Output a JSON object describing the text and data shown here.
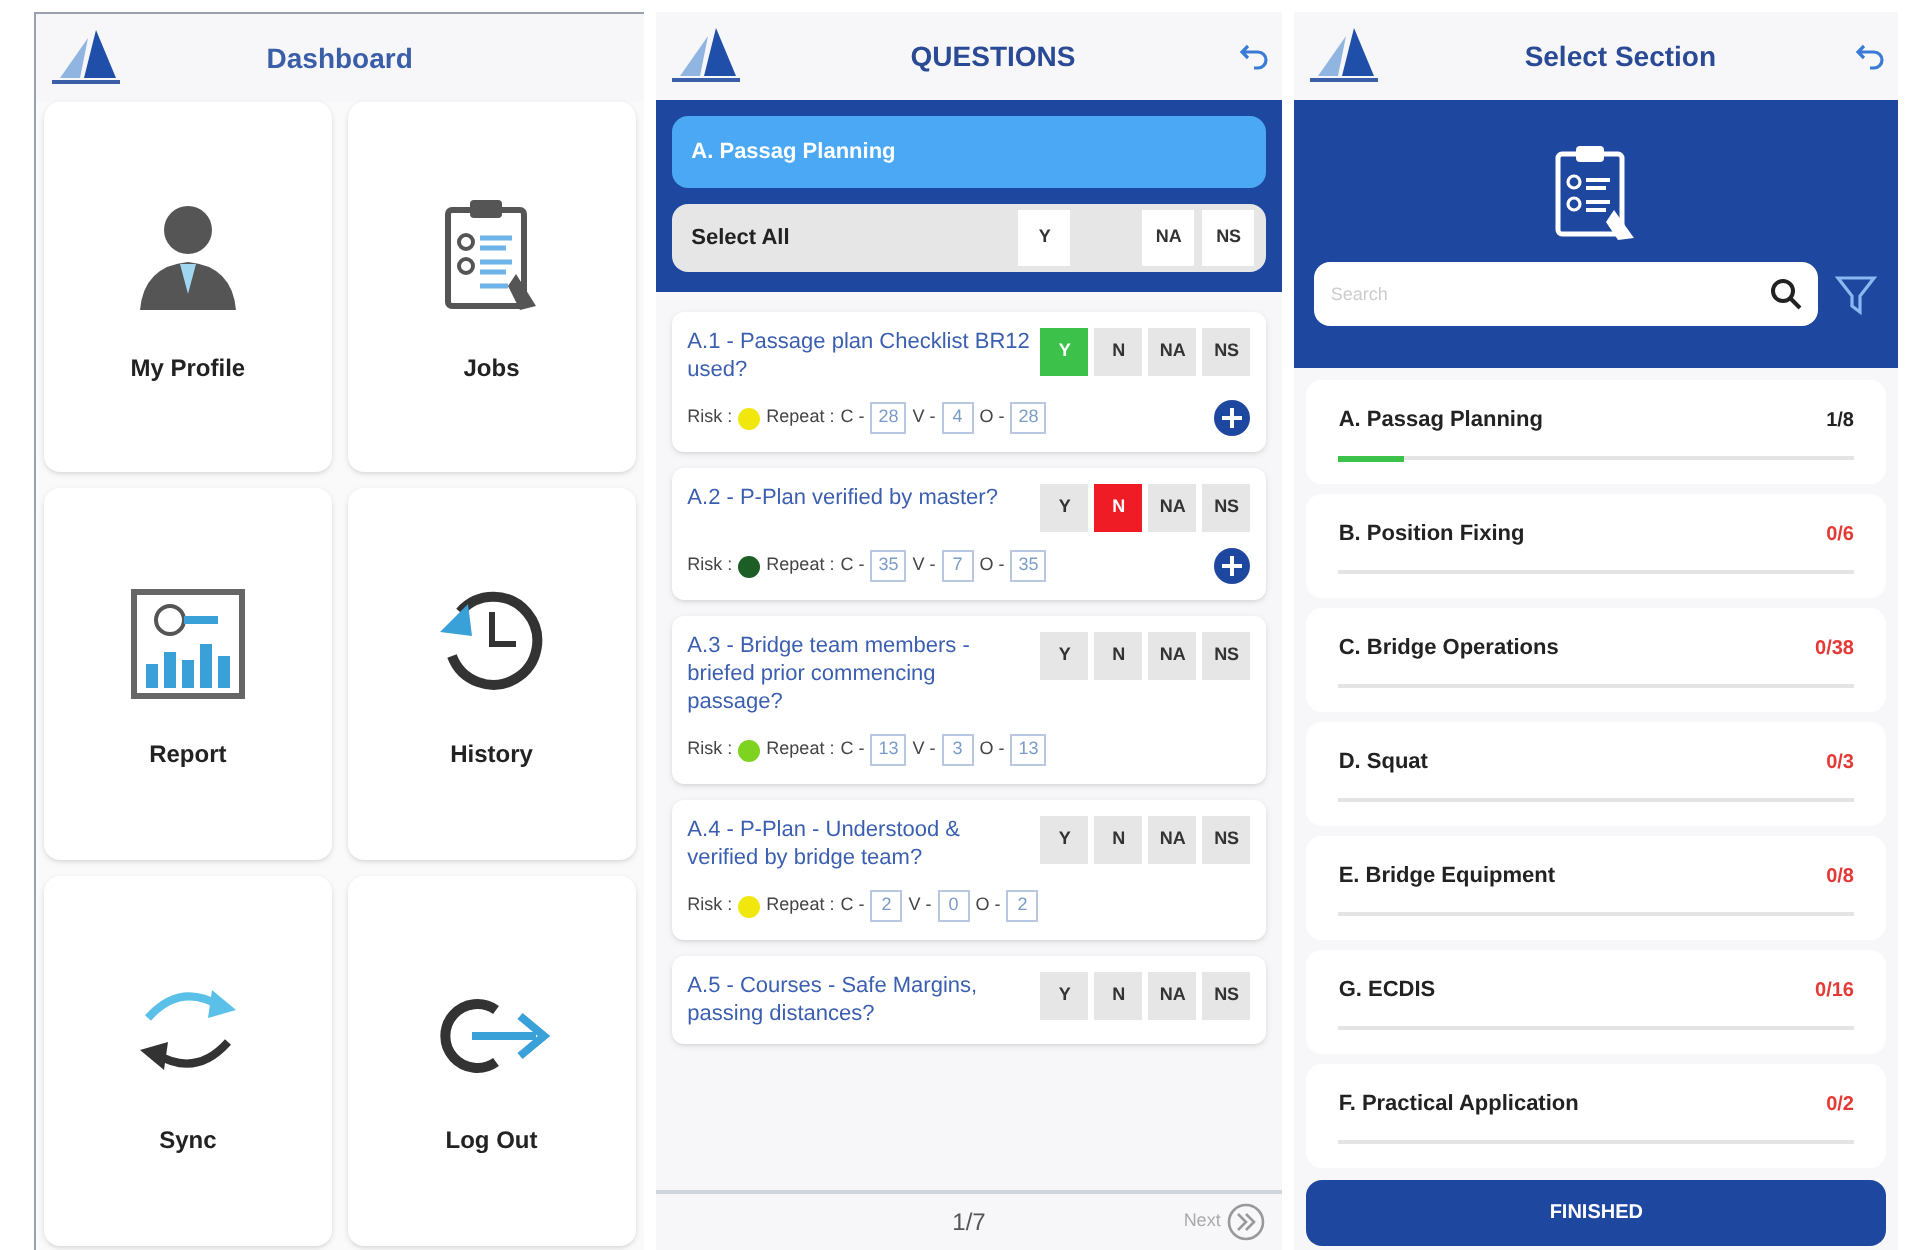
{
  "dashboard": {
    "title": "Dashboard",
    "tiles": [
      {
        "label": "My Profile",
        "kind": "profile"
      },
      {
        "label": "Jobs",
        "kind": "jobs"
      },
      {
        "label": "Report",
        "kind": "report"
      },
      {
        "label": "History",
        "kind": "history"
      },
      {
        "label": "Sync",
        "kind": "sync"
      },
      {
        "label": "Log Out",
        "kind": "logout"
      }
    ]
  },
  "questions": {
    "title": "QUESTIONS",
    "section": "A. Passag Planning",
    "select_all": {
      "label": "Select All",
      "options": [
        {
          "label": "Y"
        },
        {
          "label": "NA"
        },
        {
          "label": "NS"
        }
      ]
    },
    "items": [
      {
        "text": "A.1 - Passage plan Checklist BR12 used?",
        "options": [
          {
            "label": "Y",
            "selected": true
          },
          {
            "label": "N",
            "selected": false
          },
          {
            "label": "NA",
            "selected": false
          },
          {
            "label": "NS",
            "selected": false
          }
        ],
        "risk": {
          "label": "Risk :",
          "color": "#f2e70c",
          "repeat": "Repeat :",
          "c_label": "C -",
          "c": "28",
          "v_label": "V -",
          "v": "4",
          "o_label": "O -",
          "o": "28"
        },
        "add": true
      },
      {
        "text": "A.2 - P-Plan verified by master?",
        "options": [
          {
            "label": "Y",
            "selected": false
          },
          {
            "label": "N",
            "selected": true
          },
          {
            "label": "NA",
            "selected": false
          },
          {
            "label": "NS",
            "selected": false
          }
        ],
        "risk": {
          "label": "Risk :",
          "color": "#1d5e26",
          "repeat": "Repeat :",
          "c_label": "C -",
          "c": "35",
          "v_label": "V -",
          "v": "7",
          "o_label": "O -",
          "o": "35"
        },
        "add": true
      },
      {
        "text": "A.3 - Bridge team members - briefed prior commencing passage?",
        "options": [
          {
            "label": "Y",
            "selected": false
          },
          {
            "label": "N",
            "selected": false
          },
          {
            "label": "NA",
            "selected": false
          },
          {
            "label": "NS",
            "selected": false
          }
        ],
        "risk": {
          "label": "Risk :",
          "color": "#7ed321",
          "repeat": "Repeat :",
          "c_label": "C -",
          "c": "13",
          "v_label": "V -",
          "v": "3",
          "o_label": "O -",
          "o": "13"
        },
        "add": false
      },
      {
        "text": "A.4 - P-Plan - Understood & verified by bridge team?",
        "options": [
          {
            "label": "Y",
            "selected": false
          },
          {
            "label": "N",
            "selected": false
          },
          {
            "label": "NA",
            "selected": false
          },
          {
            "label": "NS",
            "selected": false
          }
        ],
        "risk": {
          "label": "Risk :",
          "color": "#f2e70c",
          "repeat": "Repeat :",
          "c_label": "C -",
          "c": "2",
          "v_label": "V -",
          "v": "0",
          "o_label": "O -",
          "o": "2"
        },
        "add": false
      },
      {
        "text": "A.5 - Courses - Safe Margins, passing distances?",
        "options": [
          {
            "label": "Y",
            "selected": false
          },
          {
            "label": "N",
            "selected": false
          },
          {
            "label": "NA",
            "selected": false
          },
          {
            "label": "NS",
            "selected": false
          }
        ],
        "add": false
      }
    ],
    "pager": "1/7",
    "next": "Next"
  },
  "sections": {
    "title": "Select Section",
    "search": {
      "placeholder": "Search"
    },
    "items": [
      {
        "name": "A. Passag Planning",
        "count": "1/8",
        "color": "#222222",
        "level": 0.125
      },
      {
        "name": "B. Position Fixing",
        "count": "0/6",
        "color": "#e53935"
      },
      {
        "name": "C. Bridge Operations",
        "count": "0/38",
        "color": "#e53935"
      },
      {
        "name": "D. Squat",
        "count": "0/3",
        "color": "#e53935"
      },
      {
        "name": "E. Bridge Equipment",
        "count": "0/8",
        "color": "#e53935"
      },
      {
        "name": "G. ECDIS",
        "count": "0/16",
        "color": "#e53935"
      },
      {
        "name": "F. Practical Application",
        "count": "0/2",
        "color": "#e53935"
      }
    ],
    "finish": "FINISHED"
  }
}
